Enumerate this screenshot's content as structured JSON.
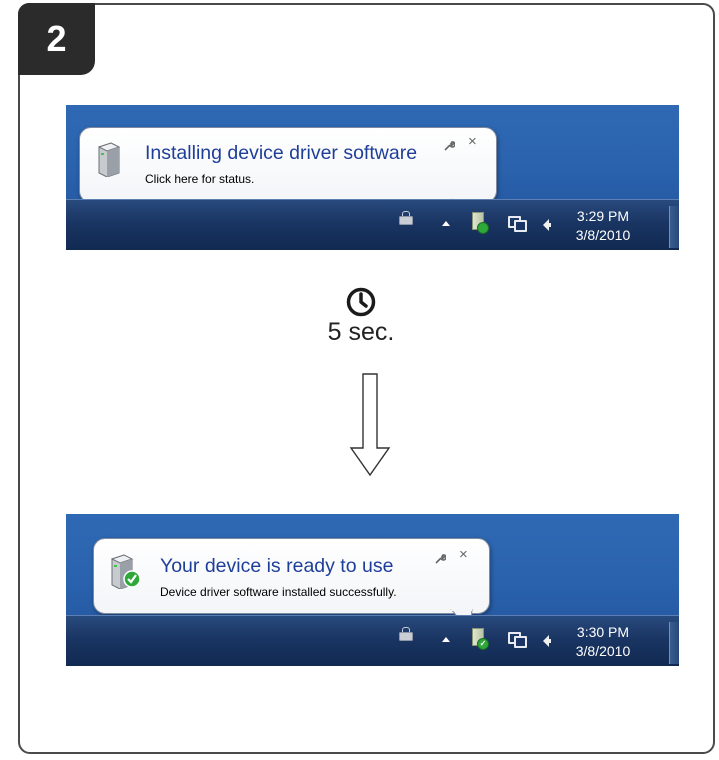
{
  "step": {
    "number": "2"
  },
  "before": {
    "balloon": {
      "title": "Installing device driver software",
      "message": "Click here for status.",
      "wrench_icon": "wrench-icon",
      "close_label": "×"
    },
    "clock": {
      "time": "3:29 PM",
      "date": "3/8/2010"
    },
    "device_badge": "installing"
  },
  "wait": {
    "icon": "clock-icon",
    "label": "5 sec.",
    "arrow": "down-arrow"
  },
  "after": {
    "balloon": {
      "title": "Your device is ready to use",
      "message": "Device driver software installed successfully.",
      "wrench_icon": "wrench-icon",
      "close_label": "×"
    },
    "clock": {
      "time": "3:30 PM",
      "date": "3/8/2010"
    },
    "device_badge": "ready"
  },
  "colors": {
    "frame_border": "#4a4a4a",
    "badge_bg": "#2b2b2b",
    "balloon_title": "#1f3e9a",
    "desktop_blue": "#2a62ad",
    "taskbar": "#1a3563",
    "success_green": "#2fa83a"
  }
}
